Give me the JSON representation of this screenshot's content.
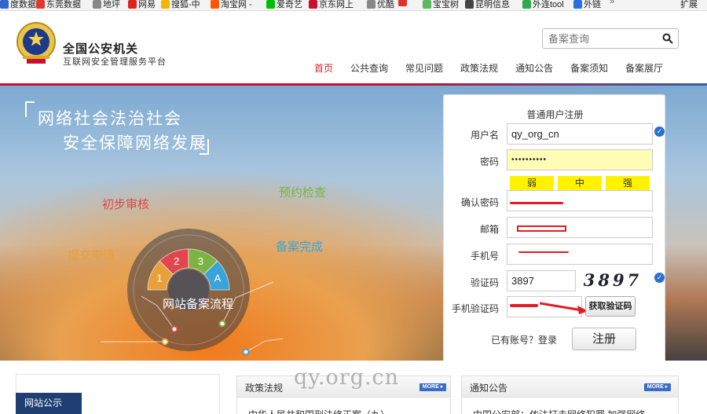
{
  "bookmarks": {
    "items": [
      {
        "label": "度数据",
        "color": "#3366cc"
      },
      {
        "label": "东莞数据",
        "color": "#e03a2f"
      },
      {
        "label": "地坪",
        "color": "#888888"
      },
      {
        "label": "网易",
        "color": "#d9251d"
      },
      {
        "label": "搜狐-中",
        "color": "#f2b705"
      },
      {
        "label": "淘宝网 -",
        "color": "#ff5500"
      },
      {
        "label": "爱奇艺",
        "color": "#00be06"
      },
      {
        "label": "京东网上",
        "color": "#c8102e"
      },
      {
        "label": "优酷",
        "color": "#888888"
      },
      {
        "label": "",
        "color": "#e0322a"
      },
      {
        "label": "宝宝树",
        "color": "#5cb85c"
      },
      {
        "label": "昆明信息",
        "color": "#444444"
      },
      {
        "label": "外连tool",
        "color": "#33a853"
      },
      {
        "label": "外链",
        "color": "#2a6fdb"
      }
    ],
    "more": "»",
    "extension": "扩展"
  },
  "header": {
    "org_title": "全国公安机关",
    "org_subtitle": "互联网安全管理服务平台",
    "search_placeholder": "备案查询",
    "nav": [
      "首页",
      "公共查询",
      "常见问题",
      "政策法规",
      "通知公告",
      "备案须知",
      "备案展厅"
    ],
    "active_nav": "首页"
  },
  "banner": {
    "slogan_line1": "网络社会法治社会",
    "slogan_line2": "安全保障网络发展",
    "stages": [
      {
        "label": "提交申请",
        "num": "1",
        "color": "#e8a03a"
      },
      {
        "label": "初步审核",
        "num": "2",
        "color": "#e0474c"
      },
      {
        "label": "预约检查",
        "num": "3",
        "color": "#7cb342"
      },
      {
        "label": "备案完成",
        "num": "A",
        "color": "#3aa3d9"
      }
    ],
    "flow_title": "网站备案流程"
  },
  "register": {
    "title": "普通用户注册",
    "labels": {
      "username": "用户名",
      "password": "密码",
      "confirm": "确认密码",
      "email": "邮箱",
      "phone": "手机号",
      "captcha": "验证码",
      "sms": "手机验证码"
    },
    "username_value": "qy_org_cn",
    "password_value": "••••••••••",
    "strength": [
      "弱",
      "中",
      "强"
    ],
    "captcha_value": "3897",
    "captcha_image_text": "3897",
    "sms_button": "获取验证码",
    "have_account": "已有账号？登录",
    "register_button": "注册"
  },
  "bottom": {
    "site_notice_tab": "网站公示",
    "policy_title": "政策法规",
    "notice_title": "通知公告",
    "more_label": "MORE",
    "policy_item": "中华人民共和国刑法修正案（九）",
    "notice_item": "中国公安部：依法打击网络犯罪 加强网络"
  },
  "watermark": "qy.org.cn",
  "colors": {
    "accent_red": "#d9212a",
    "nav_navy": "#1f3f73",
    "more_blue": "#3b6cc7",
    "strength_yellow": "#fff200"
  }
}
